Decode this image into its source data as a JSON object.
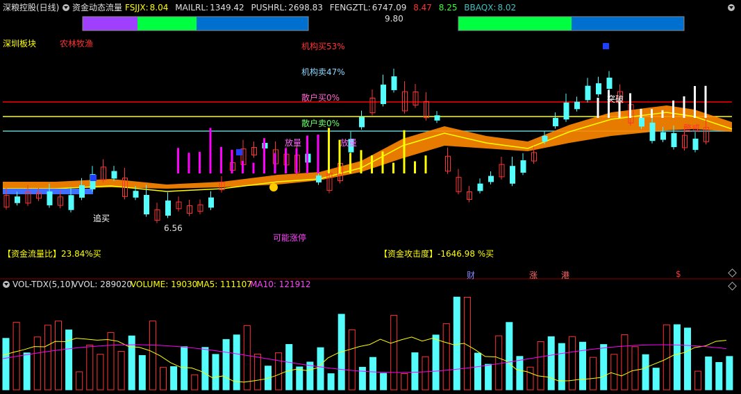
{
  "header": {
    "stock_title": "深粮控股(日线)",
    "indicator_name": "资金动态流量",
    "items": [
      {
        "label": "FSJJX:",
        "value": "8.04"
      },
      {
        "label": "MAILRL:",
        "value": "1349.42"
      },
      {
        "label": "PUSHRL:",
        "value": "2698.83"
      },
      {
        "label": "FENGZTL:",
        "value": "6747.09"
      },
      {
        "label": "",
        "value": "8.47"
      },
      {
        "label": "",
        "value": "8.25"
      },
      {
        "label": "BBAQX:",
        "value": "8.02"
      }
    ]
  },
  "main_labels": {
    "sector": "深圳板块",
    "industry": "农林牧渔",
    "inst_buy": "机构买53%",
    "inst_sell": "机构卖47%",
    "retail_buy": "散户买0%",
    "retail_sell": "散户卖0%",
    "fang_liang_1": "放量",
    "fang_liang_2": "放量",
    "zhui_mai": "追买",
    "ke_neng_zhang_ting": "可能涨停",
    "tu_po": "突破",
    "jing_jie": "警戒",
    "high_price": "9.80",
    "low_price": "6.56"
  },
  "footer_stats": {
    "flow_ratio": "【资金流量比】23.84%买",
    "attack": "【资金攻击度】-1646.98 %买"
  },
  "markers": {
    "cai": "财",
    "zhang": "涨",
    "gang": "港",
    "dollar": "$"
  },
  "volume_header": {
    "name": "VOL-TDX(5,10)",
    "vvol": "VVOL: 289020",
    "volume": "VOLUME: 19030",
    "ma5": "MA5: 111107",
    "ma10": "MA10: 121912"
  },
  "colors": {
    "up": "#ff3333",
    "down": "#54fcfc",
    "yellow": "#ffff00",
    "magenta": "#ff00ff",
    "orange": "#ff8800",
    "red_line": "#ff0000",
    "cyan_line": "#66cccc",
    "purple_bar": "#a040ff",
    "green_bar": "#00ff40",
    "blue_bar": "#0070d0"
  }
}
